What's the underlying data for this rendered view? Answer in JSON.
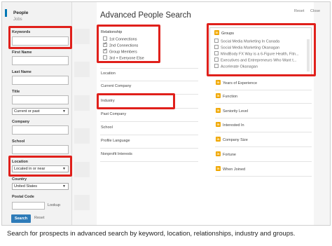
{
  "sidebar": {
    "people_label": "People",
    "jobs_label": "Jobs",
    "keywords_label": "Keywords",
    "first_name_label": "First Name",
    "last_name_label": "Last Name",
    "title_label": "Title",
    "title_scope": "Current or past",
    "company_label": "Company",
    "school_label": "School",
    "location_label": "Location",
    "location_value": "Located in or near",
    "country_label": "Country",
    "country_value": "United States",
    "postal_code_label": "Postal Code",
    "lookup_label": "Lookup",
    "search_button": "Search",
    "reset_link": "Reset"
  },
  "header": {
    "title": "Advanced People Search",
    "reset_label": "Reset",
    "close_label": "Close"
  },
  "relationship": {
    "label": "Relationship",
    "options": [
      {
        "label": "1st Connections",
        "checked": false
      },
      {
        "label": "2nd Connections",
        "checked": true
      },
      {
        "label": "Group Members",
        "checked": true
      },
      {
        "label": "3rd + Everyone Else",
        "checked": false
      }
    ]
  },
  "middle_fields": [
    "Location",
    "Current Company",
    "Industry",
    "Past Company",
    "School",
    "Profile Language",
    "Nonprofit Interests"
  ],
  "groups": {
    "label": "Groups",
    "items": [
      "Social Media Marketing In Canada",
      "Social Media Marketing Okanagan",
      "MindBody FX Way is a 6-Figure Health, Fitn...",
      "Executives and Entrepreneurs Who Want t...",
      "Accelerate Okanagan"
    ]
  },
  "premium_fields": [
    "Years of Experience",
    "Function",
    "Seniority Level",
    "Interested In",
    "Company Size",
    "Fortune",
    "When Joined"
  ],
  "premium_badge": "in",
  "caption": "Search for prospects in advanced search by keyword, location, relationships, industry and groups.",
  "colors": {
    "highlight": "#e0201b",
    "accent": "#0077b5",
    "premium_badge": "#f0a700"
  }
}
